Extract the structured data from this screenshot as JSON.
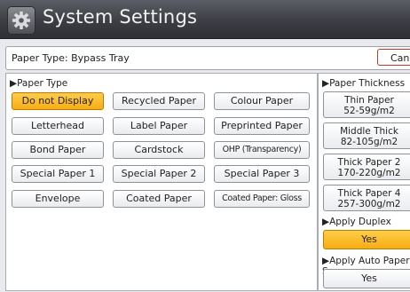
{
  "window": {
    "title": "System Settings"
  },
  "header": {
    "paper_type_label": "Paper Type: Bypass Tray",
    "cancel_label": "Cancel"
  },
  "paper_type": {
    "label": "▶Paper Type",
    "options": [
      [
        "Do not Display",
        "Recycled Paper",
        "Colour Paper"
      ],
      [
        "Letterhead",
        "Label Paper",
        "Preprinted Paper"
      ],
      [
        "Bond Paper",
        "Cardstock",
        "OHP (Transparency)"
      ],
      [
        "Special Paper 1",
        "Special Paper 2",
        "Special Paper 3"
      ],
      [
        "Envelope",
        "Coated Paper",
        "Coated Paper: Gloss"
      ]
    ],
    "selected": "Do not Display"
  },
  "paper_thickness": {
    "label": "▶Paper Thickness",
    "options": [
      {
        "name": "Thin Paper",
        "range": "52-59g/m2"
      },
      {
        "name": "Middle Thick",
        "range": "82-105g/m2"
      },
      {
        "name": "Thick Paper 2",
        "range": "170-220g/m2"
      },
      {
        "name": "Thick Paper 4",
        "range": "257-300g/m2"
      }
    ]
  },
  "apply_duplex": {
    "label": "▶Apply Duplex",
    "value": "Yes"
  },
  "apply_auto_paper": {
    "label": "▶Apply Auto Paper S",
    "value": "Yes"
  },
  "colors": {
    "selected": "#f7ad12",
    "title_bar": "#3c3e44"
  }
}
